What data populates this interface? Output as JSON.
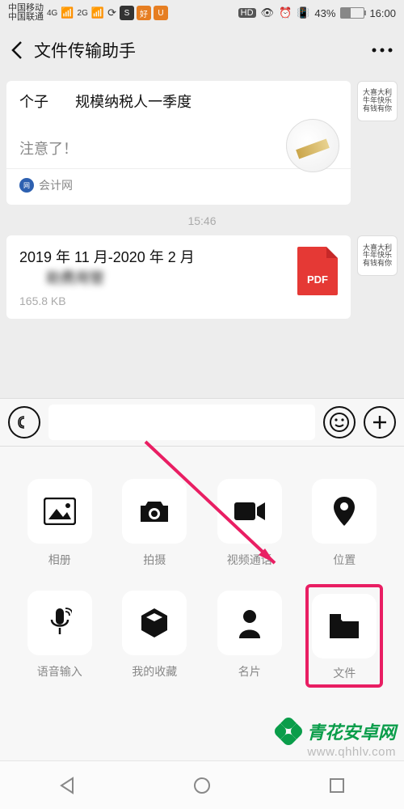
{
  "status": {
    "carrier1": "中国移动",
    "carrier2": "中国联通",
    "net1": "4G",
    "net2": "2G",
    "hd": "HD",
    "battery_pct": "43%",
    "time": "16:00"
  },
  "header": {
    "title": "文件传输助手"
  },
  "chat": {
    "msg1": {
      "line1_parts": [
        "个子",
        "ᅟᅟ",
        "规模纳税人一季度"
      ],
      "line2": "ᅟᅟᅟᅟ",
      "line3": "注意了！",
      "source": "会计网",
      "avatar_text": "大喜大利\n牛年快乐\n有钱有你"
    },
    "time": "15:46",
    "msg2": {
      "title": "2019 年 11 月-2020 年 2 月",
      "title2": "ᅟᅟ助费用管ᅟᅟ",
      "size": "165.8 KB",
      "ext": "PDF",
      "avatar_text": "大喜大利\n牛年快乐\n有钱有你"
    }
  },
  "attach": {
    "items": [
      {
        "label": "相册",
        "icon": "image"
      },
      {
        "label": "拍摄",
        "icon": "camera"
      },
      {
        "label": "视频通话",
        "icon": "video"
      },
      {
        "label": "位置",
        "icon": "location"
      },
      {
        "label": "语音输入",
        "icon": "mic"
      },
      {
        "label": "我的收藏",
        "icon": "box"
      },
      {
        "label": "名片",
        "icon": "person"
      },
      {
        "label": "文件",
        "icon": "folder"
      }
    ]
  },
  "watermark": {
    "brand": "青花安卓网",
    "url": "www.qhhlv.com"
  }
}
